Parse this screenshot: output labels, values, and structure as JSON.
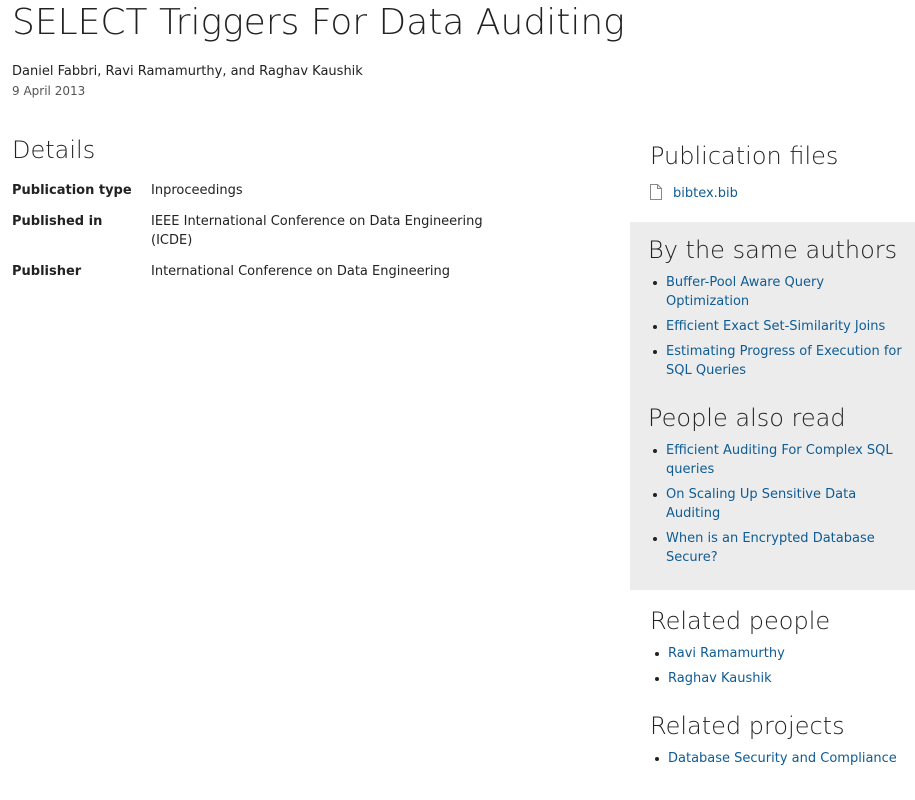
{
  "page": {
    "title": "SELECT Triggers For Data Auditing",
    "authors": "Daniel Fabbri, Ravi Ramamurthy, and Raghav Kaushik",
    "date": "9 April 2013"
  },
  "details": {
    "heading": "Details",
    "rows": [
      {
        "label": "Publication type",
        "value": "Inproceedings"
      },
      {
        "label": "Published in",
        "value": "IEEE International Conference on Data Engineering (ICDE)"
      },
      {
        "label": "Publisher",
        "value": "International Conference on Data Engineering"
      }
    ]
  },
  "publication_files": {
    "heading": "Publication files",
    "files": [
      {
        "name": "bibtex.bib",
        "icon": "file-icon"
      }
    ]
  },
  "same_authors": {
    "heading": "By the same authors",
    "items": [
      "Buffer-Pool Aware Query Optimization",
      "Efficient Exact Set-Similarity Joins",
      "Estimating Progress of Execution for SQL Queries"
    ]
  },
  "people_also_read": {
    "heading": "People also read",
    "items": [
      "Efficient Auditing For Complex SQL queries",
      "On Scaling Up Sensitive Data Auditing",
      "When is an Encrypted Database Secure?"
    ]
  },
  "related_people": {
    "heading": "Related people",
    "items": [
      "Ravi Ramamurthy",
      "Raghav Kaushik"
    ]
  },
  "related_projects": {
    "heading": "Related projects",
    "items": [
      "Database Security and Compliance"
    ]
  },
  "colors": {
    "link": "#0f5c94",
    "panel_background": "#ececec",
    "text": "#222222"
  }
}
